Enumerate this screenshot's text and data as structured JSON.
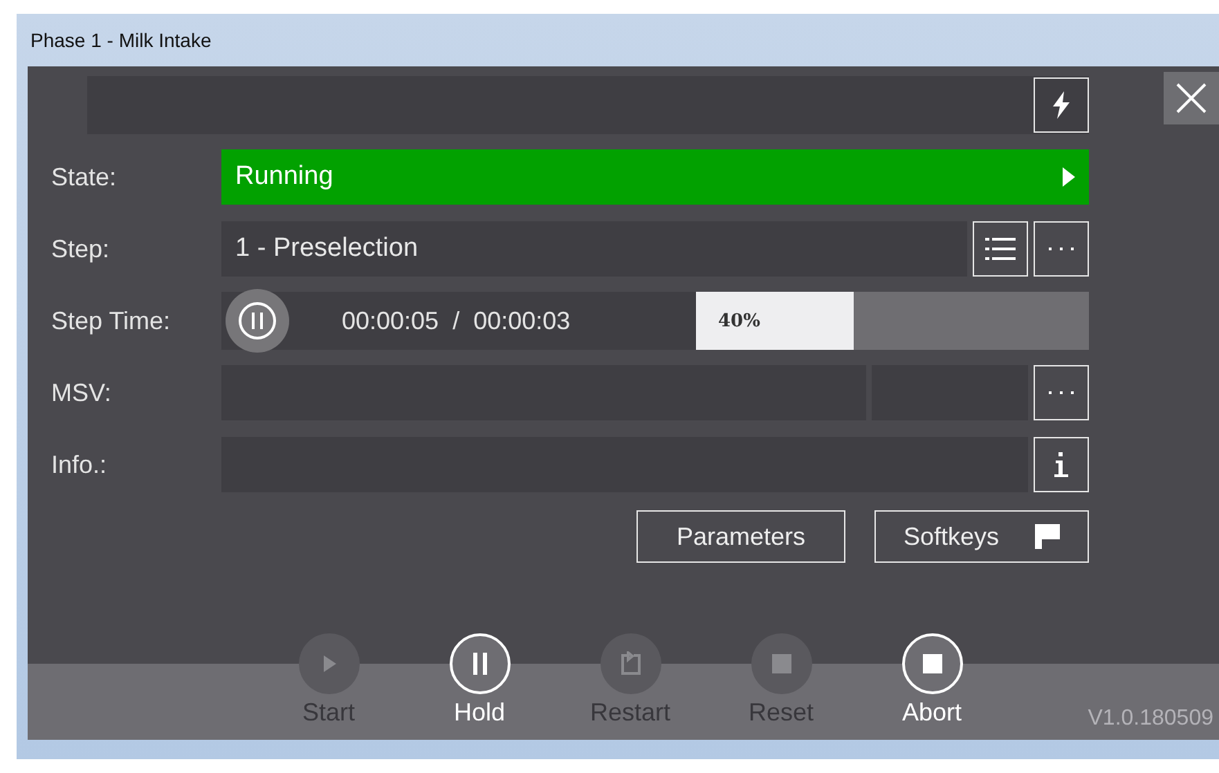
{
  "window": {
    "title": "Phase 1 - Milk Intake"
  },
  "state": {
    "label": "State:",
    "value": "Running"
  },
  "step": {
    "label": "Step:",
    "value": "1 - Preselection"
  },
  "step_time": {
    "label": "Step Time:",
    "time": "00:00:05  /  00:00:03",
    "progress": {
      "level": 0.4,
      "text": "40%"
    }
  },
  "msv": {
    "label": "MSV:"
  },
  "info": {
    "label": "Info.:"
  },
  "buttons": [
    {
      "label": "Parameters",
      "kind": "plain"
    },
    {
      "label": "Softkeys",
      "kind": "flag"
    }
  ],
  "actions": [
    {
      "label": "Start",
      "kind": "play",
      "disabled": true
    },
    {
      "label": "Hold",
      "kind": "pause",
      "disabled": false
    },
    {
      "label": "Restart",
      "kind": "restart",
      "disabled": true
    },
    {
      "label": "Reset",
      "kind": "stop",
      "disabled": true
    },
    {
      "label": "Abort",
      "kind": "stop",
      "disabled": false
    }
  ],
  "version": "V1.0.180509"
}
